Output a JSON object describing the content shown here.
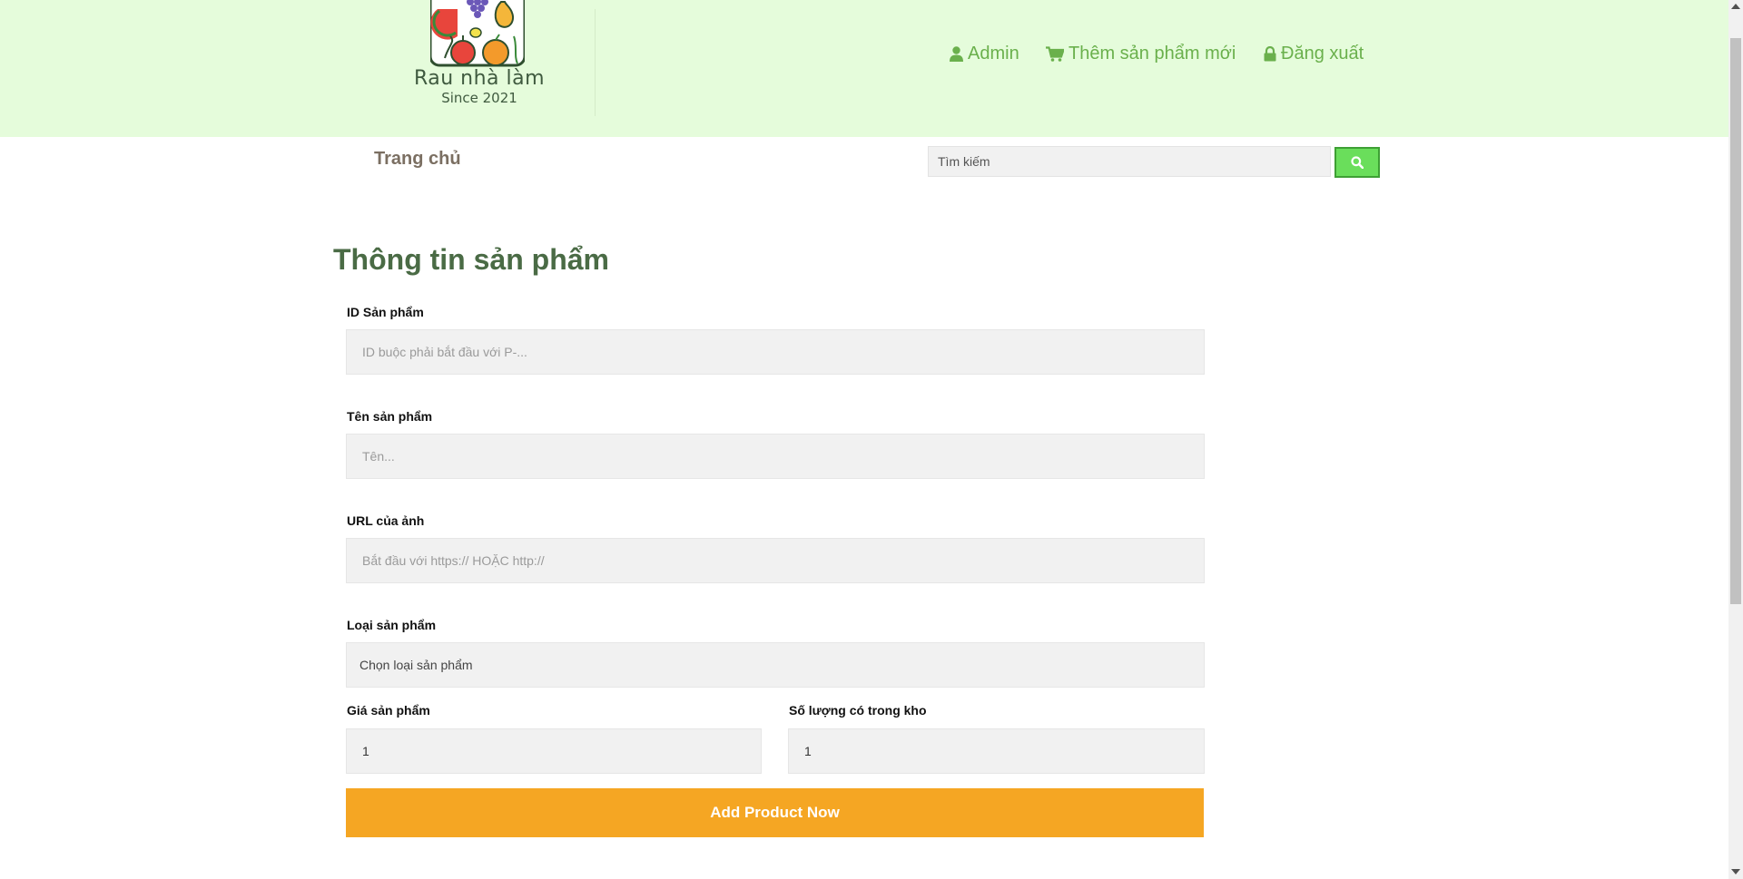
{
  "brand": {
    "name": "Rau nhà làm",
    "since": "Since 2021"
  },
  "topnav": {
    "admin": "Admin",
    "add_product": "Thêm sản phẩm mới",
    "logout": "Đăng xuất"
  },
  "subnav": {
    "home": "Trang chủ",
    "search_placeholder": "Tìm kiếm"
  },
  "form": {
    "title": "Thông tin sản phẩm",
    "id_label": "ID Sản phẩm",
    "id_placeholder": "ID buộc phải bắt đầu với P-...",
    "name_label": "Tên sản phẩm",
    "name_placeholder": "Tên...",
    "image_label": "URL của ảnh",
    "image_placeholder": "Bắt đầu với https:// HOẶC http://",
    "category_label": "Loại sản phẩm",
    "category_value": "Chọn loại sản phẩm",
    "price_label": "Giá sản phẩm",
    "price_value": "1",
    "stock_label": "Số lượng có trong kho",
    "stock_value": "1",
    "submit_label": "Add Product Now"
  },
  "colors": {
    "header_bg": "#e5fcdb",
    "nav_green": "#6ab04c",
    "title_green": "#4a6b45",
    "submit_orange": "#f5a623",
    "search_button": "#6ade5b"
  },
  "icons": [
    "user-icon",
    "cart-icon",
    "lock-icon",
    "search-icon"
  ]
}
